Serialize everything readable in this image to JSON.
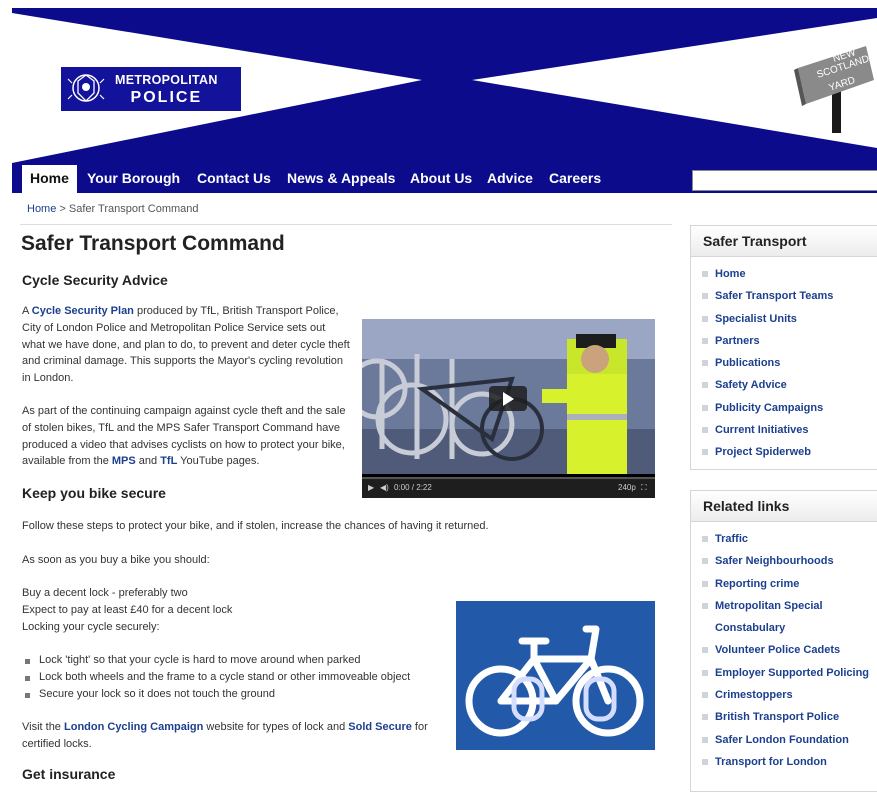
{
  "logo": {
    "line1": "METROPOLITAN",
    "line2": "POLICE"
  },
  "nsy_sign": {
    "line1": "NEW",
    "line2": "SCOTLAND",
    "line3": "YARD"
  },
  "nav": [
    "Home",
    "Your Borough",
    "Contact Us",
    "News & Appeals",
    "About Us",
    "Advice",
    "Careers"
  ],
  "search": {
    "value": ""
  },
  "breadcrumb": {
    "home": "Home",
    "sep": " > ",
    "current": "Safer Transport Command"
  },
  "main": {
    "title": "Safer Transport Command",
    "h_cycle": "Cycle Security Advice",
    "p1": {
      "a": "A ",
      "link": "Cycle Security Plan",
      "b": " produced by TfL, British Transport Police,",
      "lines": [
        "City of London Police and Metropolitan Police Service sets out",
        "what we have done, and plan to do, to prevent and deter cycle theft",
        "and criminal damage. This supports the Mayor's cycling revolution",
        "in London."
      ]
    },
    "p2": {
      "lines": [
        "As part of the continuing campaign against cycle theft and the sale",
        "of stolen bikes, TfL and the MPS Safer Transport Command have",
        "produced a video that advises cyclists on how to protect your bike,"
      ],
      "last_a": "available from the ",
      "mps": "MPS",
      "and": " and ",
      "tfl": "TfL",
      "last_b": " YouTube pages."
    },
    "video": {
      "time": "0:00 / 2:22",
      "quality": "240p"
    },
    "h_secure": "Keep you bike secure",
    "p3": "Follow these steps to protect your bike, and if stolen, increase the chances of having it returned.",
    "p4": "As soon as you buy a bike you should:",
    "p5": [
      "Buy a decent lock - preferably two",
      "Expect to pay at least £40 for a decent lock",
      "Locking your cycle securely:"
    ],
    "bullets": [
      "Lock 'tight' so that your cycle is hard to move around when parked",
      "Lock both wheels and the frame to a cycle stand or other immoveable object",
      "Secure your lock so it does not touch the ground"
    ],
    "p6": {
      "a": "Visit the ",
      "lcc": "London Cycling Campaign",
      "b": " website for types of lock and ",
      "ss": "Sold Secure",
      "c": " for",
      "d": "certified locks."
    },
    "h_insurance": "Get insurance"
  },
  "sidebar": {
    "safer_title": "Safer Transport",
    "safer_items": [
      "Home",
      "Safer Transport Teams",
      "Specialist Units",
      "Partners",
      "Publications",
      "Safety Advice",
      "Publicity Campaigns",
      "Current Initiatives",
      "Project Spiderweb"
    ],
    "related_title": "Related links",
    "related_items": [
      "Traffic",
      "Safer Neighbourhoods",
      "Reporting crime",
      "Metropolitan Special",
      "Constabulary",
      "Volunteer Police Cadets",
      "Employer Supported Policing",
      "Crimestoppers",
      "British Transport Police",
      "Safer London Foundation",
      "Transport for London"
    ]
  },
  "colors": {
    "brand_blue": "#0b0b8c",
    "link": "#1c3f8f",
    "sign_blue": "#2259a8"
  }
}
